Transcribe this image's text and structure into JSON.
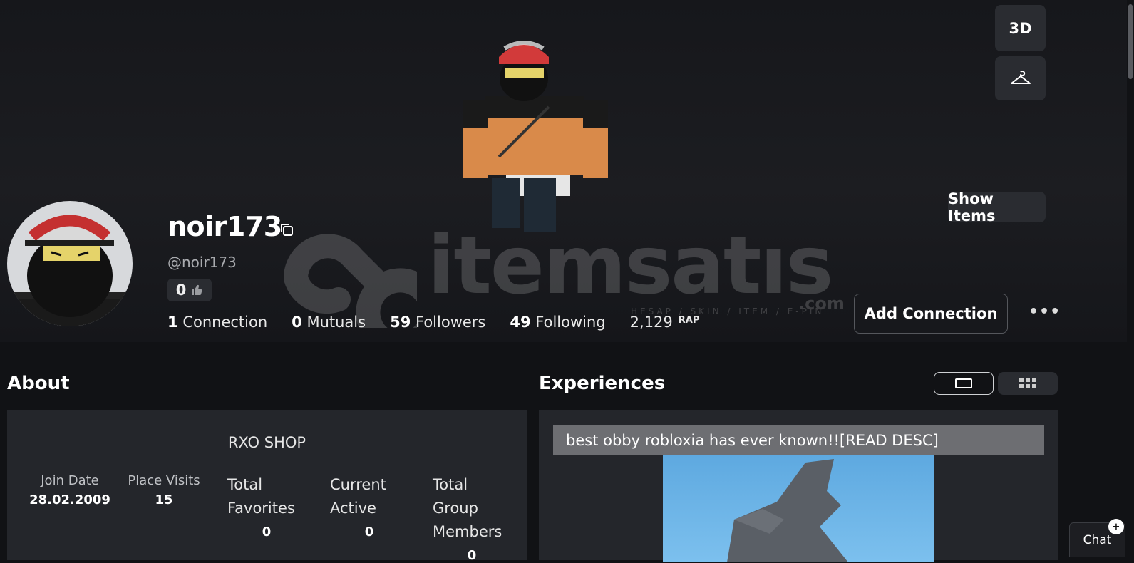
{
  "profile": {
    "display_name": "noir173",
    "handle": "@noir173",
    "likes": "0",
    "connections_count": "1",
    "connections_label": "Connection",
    "mutuals_count": "0",
    "mutuals_label": "Mutuals",
    "followers_count": "59",
    "followers_label": "Followers",
    "following_count": "49",
    "following_label": "Following",
    "rap_value": "2,129",
    "rap_label": "RAP"
  },
  "controls": {
    "btn_3d": "3D",
    "show_items": "Show Items",
    "add_connection": "Add Connection",
    "more": "•••",
    "chat": "Chat",
    "chat_badge": "+"
  },
  "watermark": {
    "text": "itemsatıs",
    "sub": "HESAP / SKIN / ITEM / E-PIN",
    "com": ".com"
  },
  "about": {
    "title": "About",
    "name": "RXO SHOP",
    "stats": [
      {
        "label": "Join Date",
        "value": "28.02.2009"
      },
      {
        "label": "Place Visits",
        "value": "15"
      },
      {
        "label": "Total Favorites",
        "value": "0"
      },
      {
        "label": "Current Active",
        "value": "0"
      },
      {
        "label": "Total Group Members",
        "value": "0"
      }
    ]
  },
  "experiences": {
    "title": "Experiences",
    "game_title": "best obby robloxia has ever known!![READ DESC]"
  },
  "colors": {
    "background": "#111215",
    "card": "#24262b",
    "button": "#2a2c31"
  }
}
